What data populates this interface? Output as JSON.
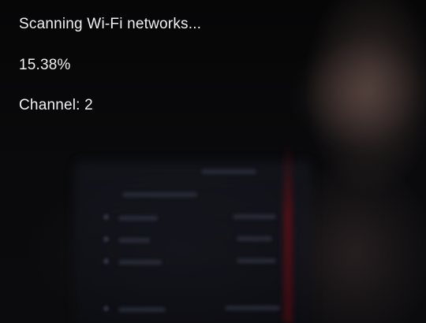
{
  "scan": {
    "status_text": "Scanning Wi-Fi networks...",
    "progress_text": "15.38%",
    "progress_value": 15.38,
    "channel_label": "Channel:",
    "channel_value": "2"
  }
}
